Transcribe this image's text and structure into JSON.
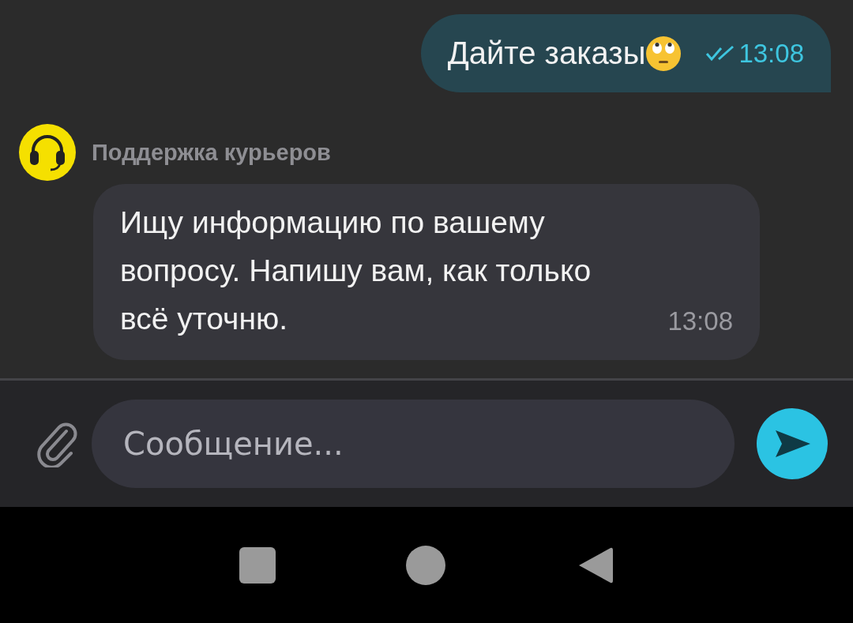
{
  "messages": [
    {
      "kind": "outgoing",
      "text": "Дайте заказы",
      "emoji": true,
      "read": true,
      "time": "13:08"
    },
    {
      "kind": "incoming",
      "sender": "Поддержка курьеров",
      "text": "Ищу информацию по вашему вопросу. Напишу вам, как только всё уточню.",
      "time": "13:08"
    }
  ],
  "composer": {
    "placeholder": "Сообщение..."
  }
}
